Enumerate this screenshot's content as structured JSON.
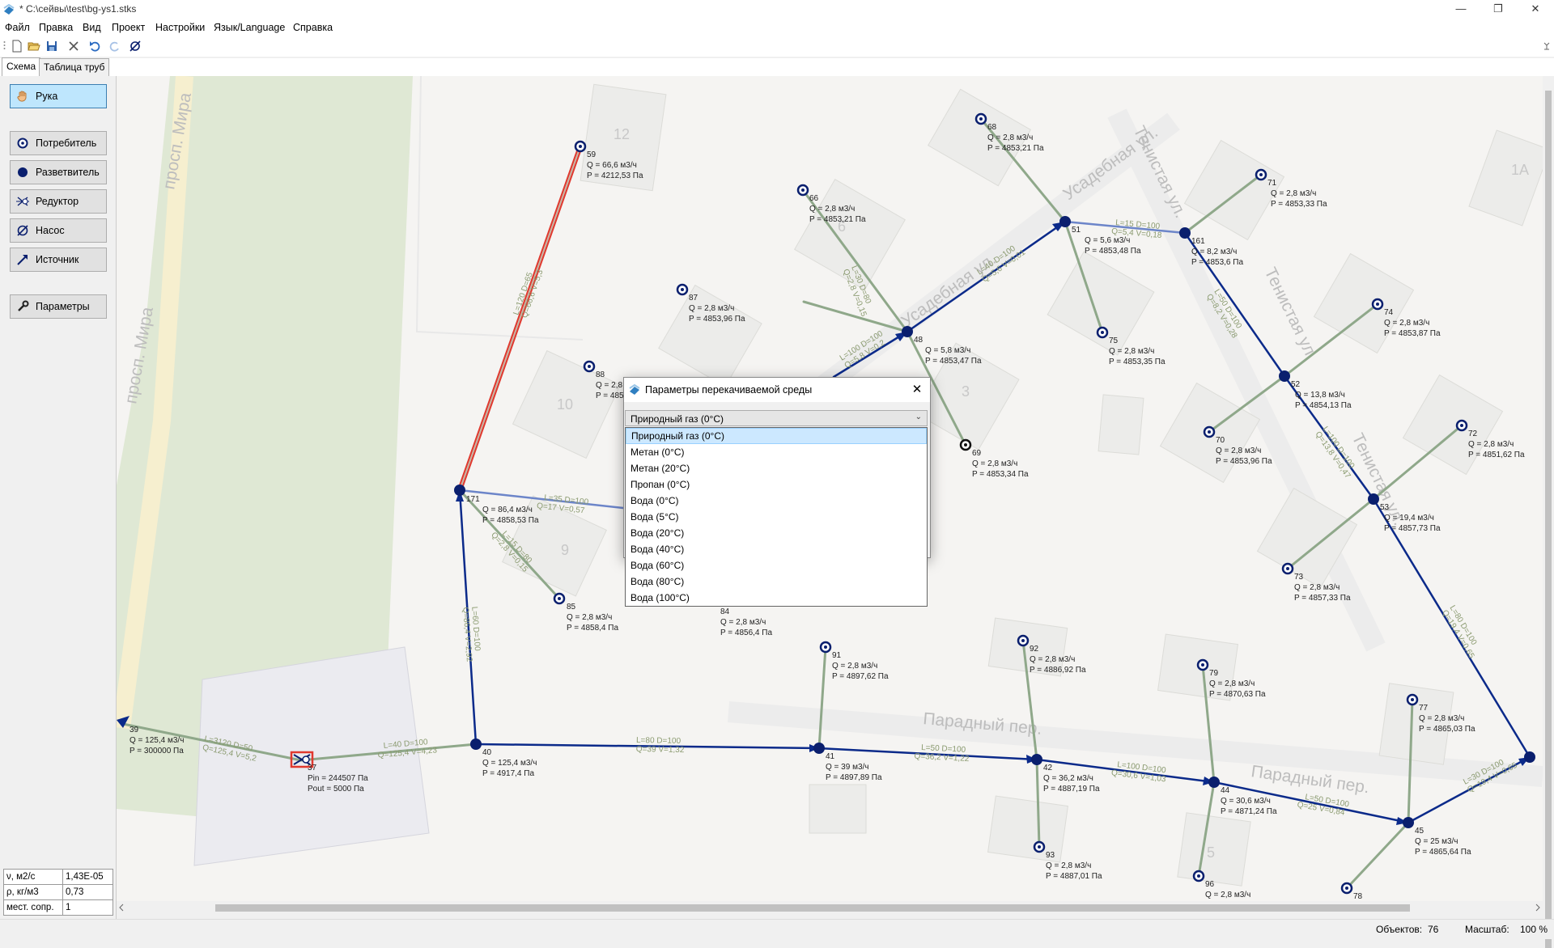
{
  "window": {
    "title": "* C:\\сейвы\\test\\bg-ys1.stks",
    "minimize": "—",
    "maximize": "❐",
    "close": "✕"
  },
  "menu": [
    "Файл",
    "Правка",
    "Вид",
    "Проект",
    "Настройки",
    "Язык/Language",
    "Справка"
  ],
  "tabs": [
    "Схема",
    "Таблица труб"
  ],
  "tools": {
    "hand": "Рука",
    "consumer": "Потребитель",
    "splitter": "Разветвитель",
    "reducer": "Редуктор",
    "pump": "Насос",
    "source": "Источник",
    "params": "Параметры"
  },
  "props": [
    {
      "label": "ν, м2/с",
      "value": "1,43E-05"
    },
    {
      "label": "ρ, кг/м3",
      "value": "0,73"
    },
    {
      "label": "мест. сопр.",
      "value": "1"
    }
  ],
  "status": {
    "objects_label": "Объектов:",
    "objects_value": "76",
    "scale_label": "Масштаб:",
    "scale_value": "100 %"
  },
  "dialog": {
    "title": "Параметры перекачиваемой среды",
    "selected": "Природный газ (0°C)",
    "options": [
      "Природный газ (0°C)",
      "Метан (0°C)",
      "Метан (20°C)",
      "Пропан (0°C)",
      "Вода (0°C)",
      "Вода (5°C)",
      "Вода (20°C)",
      "Вода (40°C)",
      "Вода (60°C)",
      "Вода (80°C)",
      "Вода (100°C)"
    ]
  },
  "map": {
    "streets": [
      "просп. Мира",
      "просп. Мира",
      "Усадебная ул.",
      "Усадебная ул.",
      "Тенистая ул.",
      "Тенистая ул.",
      "Тенистая ул.",
      "Парадный пер.",
      "Парадный пер."
    ],
    "buildings": [
      "12",
      "10",
      "9",
      "3",
      "6",
      "1А",
      "5"
    ]
  },
  "nodes": [
    {
      "id": "59",
      "q": "Q = 66,6 м3/ч",
      "p": "P = 4212,53 Па"
    },
    {
      "id": "171",
      "q": "Q = 86,4 м3/ч",
      "p": "P = 4858,53 Па"
    },
    {
      "id": "85",
      "q": "Q = 2,8 м3/ч",
      "p": "P = 4858,4 Па"
    },
    {
      "id": "88",
      "q": "Q = 2,8 м3/ч",
      "p": "P = 485"
    },
    {
      "id": "87",
      "q": "Q = 2,8 м3/ч",
      "p": "P = 4853,96 Па"
    },
    {
      "id": "66",
      "q": "Q = 2,8 м3/ч",
      "p": "P = 4853,21 Па"
    },
    {
      "id": "68",
      "q": "Q = 2,8 м3/ч",
      "p": "P = 4853,21 Па"
    },
    {
      "id": "48",
      "q": "Q = 5,8 м3/ч",
      "p": "P = 4853,47 Па"
    },
    {
      "id": "69",
      "q": "Q = 2,8 м3/ч",
      "p": "P = 4853,34 Па"
    },
    {
      "id": "51",
      "q": "Q = 5,6 м3/ч",
      "p": "P = 4853,48 Па"
    },
    {
      "id": "75",
      "q": "Q = 2,8 м3/ч",
      "p": "P = 4853,35 Па"
    },
    {
      "id": "161",
      "q": "Q = 8,2 м3/ч",
      "p": "P = 4853,6 Па"
    },
    {
      "id": "71",
      "q": "Q = 2,8 м3/ч",
      "p": "P = 4853,33 Па"
    },
    {
      "id": "74",
      "q": "Q = 2,8 м3/ч",
      "p": "P = 4853,87 Па"
    },
    {
      "id": "52",
      "q": "Q = 13,8 м3/ч",
      "p": "P = 4854,13 Па"
    },
    {
      "id": "70",
      "q": "Q = 2,8 м3/ч",
      "p": "P = 4853,96 Па"
    },
    {
      "id": "72",
      "q": "Q = 2,8 м3/ч",
      "p": "P = 4851,62 Па"
    },
    {
      "id": "53",
      "q": "Q = 19,4 м3/ч",
      "p": "P = 4857,73 Па"
    },
    {
      "id": "73",
      "q": "Q = 2,8 м3/ч",
      "p": "P = 4857,33 Па"
    },
    {
      "id": "84",
      "q": "Q = 2,8 м3/ч",
      "p": "P = 4856,4 Па"
    },
    {
      "id": "39",
      "q": "Q = 125,4 м3/ч",
      "p": "P = 300000 Па"
    },
    {
      "id": "37",
      "q": "Pin = 244507 Па",
      "p": "Pout = 5000 Па"
    },
    {
      "id": "40",
      "q": "Q = 125,4 м3/ч",
      "p": "P = 4917,4 Па"
    },
    {
      "id": "91",
      "q": "Q = 2,8 м3/ч",
      "p": "P = 4897,62 Па"
    },
    {
      "id": "41",
      "q": "Q = 39 м3/ч",
      "p": "P = 4897,89 Па"
    },
    {
      "id": "92",
      "q": "Q = 2,8 м3/ч",
      "p": "P = 4886,92 Па"
    },
    {
      "id": "42",
      "q": "Q = 36,2 м3/ч",
      "p": "P = 4887,19 Па"
    },
    {
      "id": "93",
      "q": "Q = 2,8 м3/ч",
      "p": "P = 4887,01 Па"
    },
    {
      "id": "79",
      "q": "Q = 2,8 м3/ч",
      "p": "P = 4870,63 Па"
    },
    {
      "id": "44",
      "q": "Q = 30,6 м3/ч",
      "p": "P = 4871,24 Па"
    },
    {
      "id": "96",
      "q": "Q = 2,8 м3/ч",
      "p": ""
    },
    {
      "id": "77",
      "q": "Q = 2,8 м3/ч",
      "p": "P = 4865,03 Па"
    },
    {
      "id": "45",
      "q": "Q = 25 м3/ч",
      "p": "P = 4865,64 Па"
    },
    {
      "id": "78",
      "q": "",
      "p": ""
    }
  ],
  "pipes": [
    {
      "l": "L=120  D=65",
      "q": "Q=66,6  V=5,3"
    },
    {
      "l": "L=60  D=100",
      "q": "Q=86,4  V=2,92"
    },
    {
      "l": "L=35  D=100",
      "q": "Q=17  V=0,57"
    },
    {
      "l": "L=15  D=80",
      "q": "Q=2,8  V=0,15"
    },
    {
      "l": "L=3120  D=50",
      "q": "Q=125,4  V=5,2"
    },
    {
      "l": "L=40  D=100",
      "q": "Q=125,4  V=4,23"
    },
    {
      "l": "L=80  D=100",
      "q": "Q=39  V=1,32"
    },
    {
      "l": "L=50  D=100",
      "q": "Q=36,2  V=1,22"
    },
    {
      "l": "L=100  D=100",
      "q": "Q=30,6  V=1,03"
    },
    {
      "l": "L=50  D=100",
      "q": "Q=25  V=0,84"
    },
    {
      "l": "L=30  D=100",
      "q": "Q=19,4  V=0,65"
    },
    {
      "l": "L=80  D=100",
      "q": "Q=19,4  V=0,65"
    },
    {
      "l": "L=100  D=100",
      "q": "Q=5,8  V=0,2"
    },
    {
      "l": "L=40  D=100",
      "q": "Q=5,6  V=0,01"
    },
    {
      "l": "L=15  D=100",
      "q": "Q=5,4  V=0,18"
    },
    {
      "l": "L=50  D=100",
      "q": "Q=8,2  V=0,28"
    },
    {
      "l": "L=100  D=100",
      "q": "Q=13,8  V=0,47"
    },
    {
      "l": "L=30  D=80",
      "q": "Q=2,8  V=0,15"
    }
  ]
}
